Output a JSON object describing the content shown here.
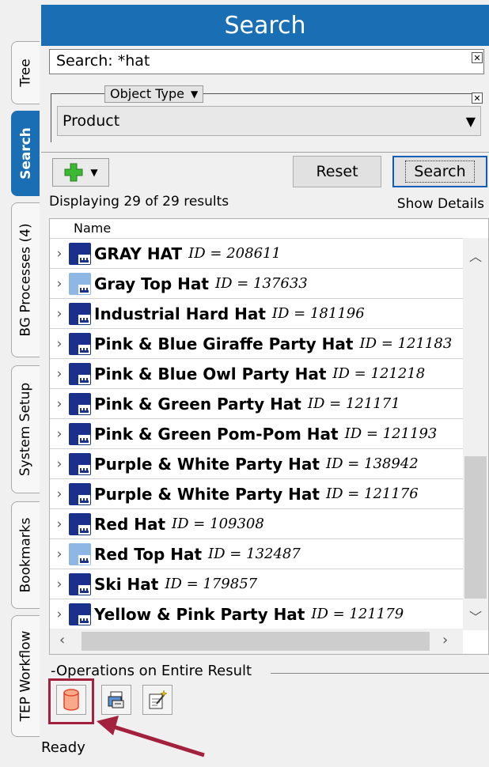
{
  "tabs": [
    {
      "label": "Tree",
      "active": false
    },
    {
      "label": "Search",
      "active": true
    },
    {
      "label": "BG Processes (4)",
      "active": false
    },
    {
      "label": "System Setup",
      "active": false
    },
    {
      "label": "Bookmarks",
      "active": false
    },
    {
      "label": "TEP Workflow",
      "active": false
    }
  ],
  "panel": {
    "title": "Search",
    "search_value": "Search: *hat",
    "filter": {
      "label": "Object Type",
      "value": "Product"
    },
    "buttons": {
      "reset": "Reset",
      "search": "Search"
    },
    "status": "Displaying 29 of 29 results",
    "show_details": "Show Details"
  },
  "results": {
    "column_header": "Name",
    "rows": [
      {
        "name": "GRAY HAT",
        "id": "ID = 208611",
        "icon": "product-icon-dark"
      },
      {
        "name": "Gray Top Hat",
        "id": "ID = 137633",
        "icon": "product-icon-light"
      },
      {
        "name": "Industrial Hard Hat",
        "id": "ID = 181196",
        "icon": "product-icon-dark"
      },
      {
        "name": "Pink & Blue Giraffe Party Hat",
        "id": "ID = 121183",
        "icon": "product-icon-dark"
      },
      {
        "name": "Pink & Blue Owl Party Hat",
        "id": "ID = 121218",
        "icon": "product-icon-dark"
      },
      {
        "name": "Pink & Green Party Hat",
        "id": "ID = 121171",
        "icon": "product-icon-dark"
      },
      {
        "name": "Pink & Green Pom-Pom Hat",
        "id": "ID = 121193",
        "icon": "product-icon-dark"
      },
      {
        "name": "Purple & White Party Hat",
        "id": "ID = 138942",
        "icon": "product-icon-dark"
      },
      {
        "name": "Purple & White Party Hat",
        "id": "ID = 121176",
        "icon": "product-icon-dark"
      },
      {
        "name": "Red Hat",
        "id": "ID = 109308",
        "icon": "product-icon-dark"
      },
      {
        "name": "Red Top Hat",
        "id": "ID = 132487",
        "icon": "product-icon-light"
      },
      {
        "name": "Ski Hat",
        "id": "ID = 179857",
        "icon": "product-icon-dark"
      },
      {
        "name": "Yellow & Pink Party Hat",
        "id": "ID = 121179",
        "icon": "product-icon-dark"
      }
    ]
  },
  "operations": {
    "title": "Operations on Entire Result",
    "buttons": [
      "database-icon",
      "export-icon",
      "wizard-icon"
    ]
  },
  "status_bar": "Ready",
  "colors": {
    "accent": "#1a6fb4",
    "highlight": "#a3213d",
    "product_dark": "#1b2f8c",
    "product_light": "#8fb7e6"
  }
}
